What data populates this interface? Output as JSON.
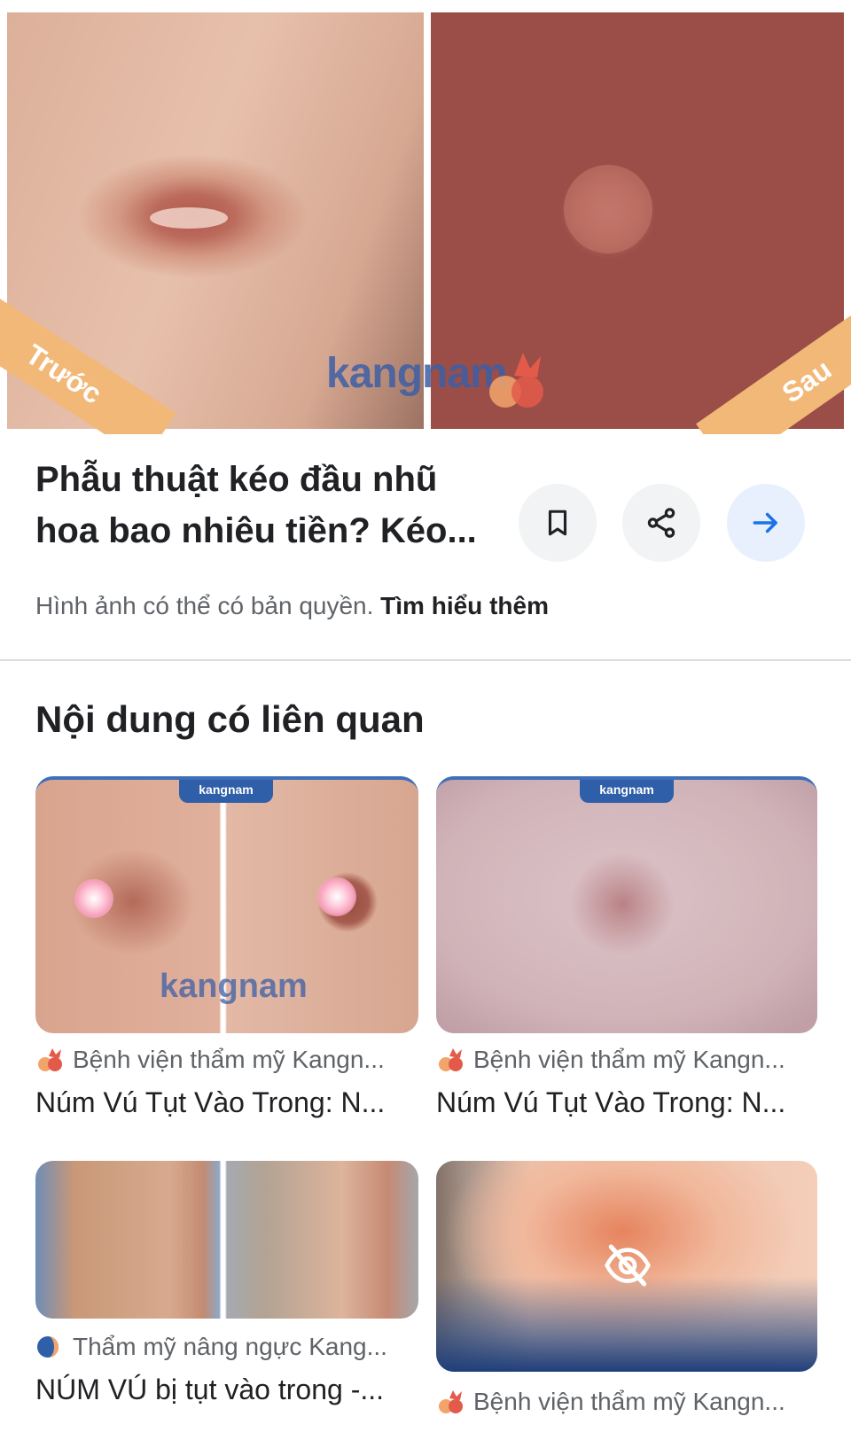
{
  "hero": {
    "label_before": "Trước",
    "label_after": "Sau",
    "watermark": "kangnam"
  },
  "result": {
    "title": "Phẫu thuật kéo đầu nhũ hoa bao nhiêu tiền? Kéo...",
    "copyright_text": "Hình ảnh có thể có bản quyền.",
    "learn_more": "Tìm hiểu thêm",
    "actions": [
      {
        "icon": "bookmark-icon"
      },
      {
        "icon": "share-icon"
      },
      {
        "icon": "arrow-right-icon",
        "color": "#1a73e8"
      }
    ]
  },
  "related": {
    "heading": "Nội dung có liên quan",
    "cards": [
      {
        "source": "Bệnh viện thẩm mỹ Kangn...",
        "title": "Núm Vú Tụt Vào Trong: N...",
        "badge": "kangnam"
      },
      {
        "source": "Bệnh viện thẩm mỹ Kangn...",
        "title": "Núm Vú Tụt Vào Trong: N...",
        "badge": "kangnam"
      },
      {
        "source": "Thẩm mỹ nâng ngực Kang...",
        "title": "NÚM VÚ bị tụt vào trong -..."
      },
      {
        "source": "Bệnh viện thẩm mỹ Kangn...",
        "icon": "eye-off-icon"
      }
    ]
  },
  "colors": {
    "accent": "#1a73e8",
    "badge_blue": "#2f5fa8",
    "ribbon_orange": "#f2b878"
  }
}
